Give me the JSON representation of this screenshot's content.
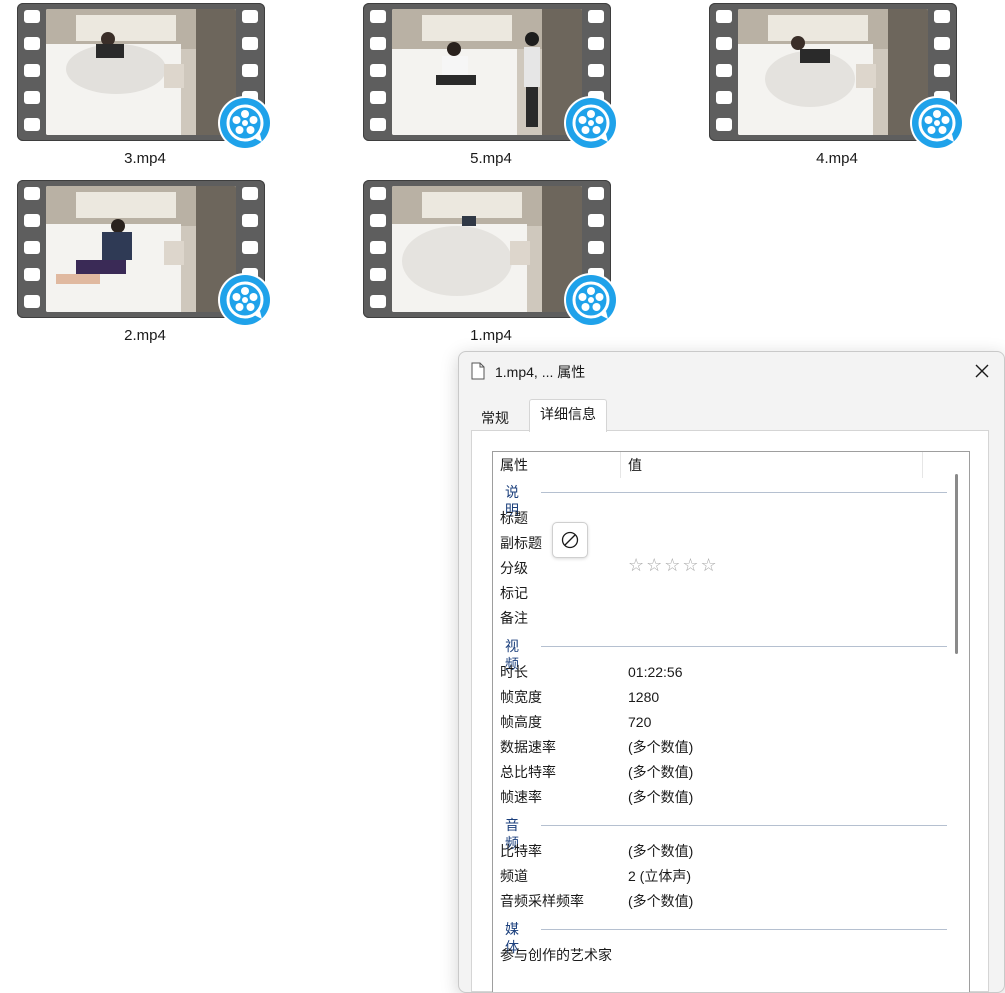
{
  "files": [
    {
      "name": "3.mp4"
    },
    {
      "name": "5.mp4"
    },
    {
      "name": "4.mp4"
    },
    {
      "name": "2.mp4"
    },
    {
      "name": "1.mp4"
    }
  ],
  "dialog": {
    "title": "1.mp4, ... 属性",
    "tabs": [
      "常规",
      "详细信息"
    ],
    "active_tab": "详细信息",
    "columns": {
      "property": "属性",
      "value": "值"
    },
    "groups": {
      "description": {
        "label": "说明",
        "rows": {
          "title": {
            "label": "标题",
            "value": ""
          },
          "subtitle": {
            "label": "副标题",
            "value": ""
          },
          "rating": {
            "label": "分级",
            "stars": 0,
            "max_stars": 5,
            "star_glyphs": "☆☆☆☆☆"
          },
          "tags": {
            "label": "标记",
            "value": ""
          },
          "comments": {
            "label": "备注",
            "value": ""
          }
        }
      },
      "video": {
        "label": "视频",
        "rows": {
          "length": {
            "label": "时长",
            "value": "01:22:56"
          },
          "frame_width": {
            "label": "帧宽度",
            "value": "1280"
          },
          "frame_height": {
            "label": "帧高度",
            "value": "720"
          },
          "data_rate": {
            "label": "数据速率",
            "value": "(多个数值)"
          },
          "total_bitrate": {
            "label": "总比特率",
            "value": "(多个数值)"
          },
          "frame_rate": {
            "label": "帧速率",
            "value": "(多个数值)"
          }
        }
      },
      "audio": {
        "label": "音频",
        "rows": {
          "bitrate": {
            "label": "比特率",
            "value": "(多个数值)"
          },
          "channels": {
            "label": "频道",
            "value": "2 (立体声)"
          },
          "sample_rate": {
            "label": "音频采样频率",
            "value": "(多个数值)"
          }
        }
      },
      "media": {
        "label": "媒体",
        "rows": {
          "contributing_artists": {
            "label": "参与创作的艺术家",
            "value": ""
          }
        }
      }
    }
  },
  "icons": {
    "file": "document-icon",
    "close": "close-icon",
    "clear": "clear-value-icon",
    "player_badge": "video-player-badge-icon"
  },
  "colors": {
    "badge": "#1fa2ea",
    "group_label": "#1b3f7c",
    "film_strip": "#5e5e5e"
  }
}
